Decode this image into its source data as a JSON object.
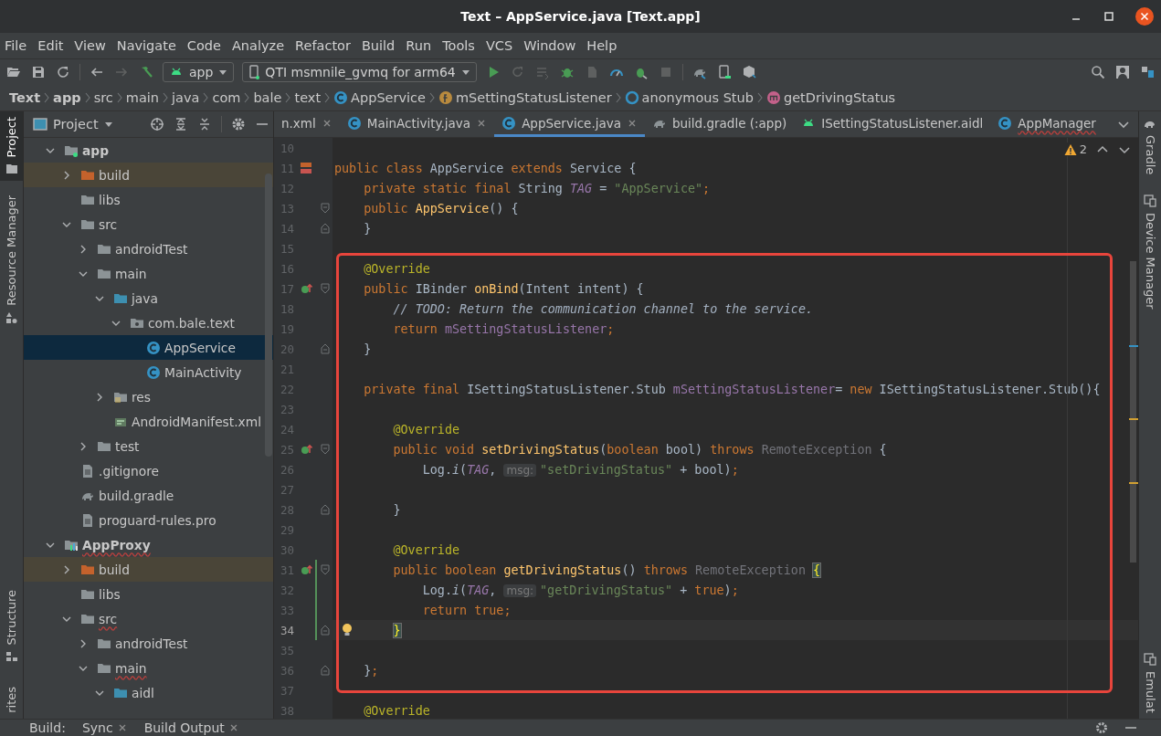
{
  "window": {
    "title": "Text – AppService.java [Text.app]"
  },
  "menu": [
    "File",
    "Edit",
    "View",
    "Navigate",
    "Code",
    "Analyze",
    "Refactor",
    "Build",
    "Run",
    "Tools",
    "VCS",
    "Window",
    "Help"
  ],
  "toolbar": {
    "configurations": [
      {
        "label": "app",
        "kind": "android"
      },
      {
        "label": "QTI msmnile_gvmq for arm64",
        "kind": "device"
      }
    ]
  },
  "breadcrumb": [
    {
      "label": "Text",
      "kind": "bold"
    },
    {
      "label": "app",
      "kind": "bold"
    },
    {
      "label": "src",
      "kind": "plain"
    },
    {
      "label": "main",
      "kind": "plain"
    },
    {
      "label": "java",
      "kind": "plain"
    },
    {
      "label": "com",
      "kind": "plain"
    },
    {
      "label": "bale",
      "kind": "plain"
    },
    {
      "label": "text",
      "kind": "plain"
    },
    {
      "label": "AppService",
      "kind": "class"
    },
    {
      "label": "mSettingStatusListener",
      "kind": "field"
    },
    {
      "label": "anonymous Stub",
      "kind": "anonymous"
    },
    {
      "label": "getDrivingStatus",
      "kind": "method"
    }
  ],
  "left_tool_strip": [
    {
      "label": "Project",
      "selected": true
    },
    {
      "label": "Resource Manager",
      "selected": false
    },
    {
      "label": "Structure",
      "selected": false
    },
    {
      "label": "rites",
      "selected": false
    }
  ],
  "project": {
    "title": "Project",
    "tree": [
      {
        "label": "app",
        "kind": "module",
        "expanded": true,
        "selected": false,
        "error": false,
        "children": [
          {
            "label": "build",
            "kind": "excluded",
            "expanded": false,
            "selected": false,
            "error": false
          },
          {
            "label": "libs",
            "kind": "folder",
            "selected": false,
            "error": false
          },
          {
            "label": "src",
            "kind": "folder",
            "expanded": true,
            "selected": false,
            "error": false,
            "children": [
              {
                "label": "androidTest",
                "kind": "folder",
                "expanded": false,
                "selected": false,
                "error": false
              },
              {
                "label": "main",
                "kind": "folder",
                "expanded": true,
                "selected": false,
                "error": false,
                "children": [
                  {
                    "label": "java",
                    "kind": "source",
                    "expanded": true,
                    "selected": false,
                    "error": false,
                    "children": [
                      {
                        "label": "com.bale.text",
                        "kind": "package",
                        "expanded": true,
                        "selected": false,
                        "error": false,
                        "children": [
                          {
                            "label": "AppService",
                            "kind": "class",
                            "selected": true,
                            "error": false
                          },
                          {
                            "label": "MainActivity",
                            "kind": "class",
                            "selected": false,
                            "error": false
                          }
                        ]
                      }
                    ]
                  },
                  {
                    "label": "res",
                    "kind": "res",
                    "expanded": false,
                    "selected": false,
                    "error": false
                  },
                  {
                    "label": "AndroidManifest.xml",
                    "kind": "manifest",
                    "selected": false,
                    "error": false
                  }
                ]
              },
              {
                "label": "test",
                "kind": "folder",
                "expanded": false,
                "selected": false,
                "error": false
              }
            ]
          },
          {
            "label": ".gitignore",
            "kind": "file",
            "selected": false,
            "error": false
          },
          {
            "label": "build.gradle",
            "kind": "gradle",
            "selected": false,
            "error": false
          },
          {
            "label": "proguard-rules.pro",
            "kind": "file",
            "selected": false,
            "error": false
          }
        ]
      },
      {
        "label": "AppProxy",
        "kind": "library",
        "expanded": true,
        "selected": false,
        "error": true,
        "children": [
          {
            "label": "build",
            "kind": "excluded",
            "expanded": false,
            "selected": false,
            "error": false
          },
          {
            "label": "libs",
            "kind": "folder",
            "selected": false,
            "error": false
          },
          {
            "label": "src",
            "kind": "folder",
            "expanded": true,
            "selected": false,
            "error": true,
            "children": [
              {
                "label": "androidTest",
                "kind": "folder",
                "expanded": false,
                "selected": false,
                "error": false
              },
              {
                "label": "main",
                "kind": "folder",
                "expanded": true,
                "selected": false,
                "error": true,
                "children": [
                  {
                    "label": "aidl",
                    "kind": "source",
                    "expanded": true,
                    "selected": false,
                    "error": false
                  }
                ]
              }
            ]
          }
        ]
      }
    ]
  },
  "editor": {
    "tabs": [
      {
        "label": "n.xml",
        "kind": "partial",
        "closable": true,
        "selected": false,
        "error": false
      },
      {
        "label": "MainActivity.java",
        "kind": "class",
        "closable": true,
        "selected": false,
        "error": false
      },
      {
        "label": "AppService.java",
        "kind": "class",
        "closable": true,
        "selected": true,
        "error": false
      },
      {
        "label": "build.gradle (:app)",
        "kind": "gradle",
        "closable": false,
        "selected": false,
        "error": false
      },
      {
        "label": "ISettingStatusListener.aidl",
        "kind": "android",
        "closable": false,
        "selected": false,
        "error": false
      },
      {
        "label": "AppManager",
        "kind": "class",
        "closable": false,
        "selected": false,
        "error": true
      }
    ],
    "problems": "2",
    "lines": [
      {
        "number": "10",
        "current": false,
        "changed": false
      },
      {
        "number": "11",
        "marker": {
          "kind": "class"
        },
        "current": false,
        "changed": false,
        "tokens": [
          {
            "kind": "kw",
            "text": "public class "
          },
          {
            "kind": "plain",
            "text": "AppService "
          },
          {
            "kind": "kw",
            "text": "extends "
          },
          {
            "kind": "plain",
            "text": "Service {"
          }
        ]
      },
      {
        "number": "12",
        "current": false,
        "changed": false,
        "tokens": [
          {
            "kind": "kw",
            "text": "    private static final "
          },
          {
            "kind": "plain",
            "text": "String "
          },
          {
            "kind": "tag",
            "text": "TAG"
          },
          {
            "kind": "plain",
            "text": " = "
          },
          {
            "kind": "str",
            "text": "\"AppService\""
          },
          {
            "kind": "kw",
            "text": ";"
          }
        ]
      },
      {
        "number": "13",
        "fold": {
          "kind": "open"
        },
        "current": false,
        "changed": false,
        "tokens": [
          {
            "kind": "kw",
            "text": "    public "
          },
          {
            "kind": "fn",
            "text": "AppService"
          },
          {
            "kind": "plain",
            "text": "() {"
          }
        ]
      },
      {
        "number": "14",
        "fold": {
          "kind": "close"
        },
        "current": false,
        "changed": false,
        "tokens": [
          {
            "kind": "plain",
            "text": "    }"
          }
        ]
      },
      {
        "number": "15",
        "current": false,
        "changed": false
      },
      {
        "number": "16",
        "current": false,
        "changed": false,
        "tokens": [
          {
            "kind": "ann",
            "text": "    @Override"
          }
        ]
      },
      {
        "number": "17",
        "marker": {
          "kind": "override"
        },
        "fold": {
          "kind": "open"
        },
        "current": false,
        "changed": false,
        "tokens": [
          {
            "kind": "kw",
            "text": "    public "
          },
          {
            "kind": "plain",
            "text": "IBinder "
          },
          {
            "kind": "fn",
            "text": "onBind"
          },
          {
            "kind": "plain",
            "text": "(Intent intent) {"
          }
        ]
      },
      {
        "number": "18",
        "current": false,
        "changed": false,
        "tokens": [
          {
            "kind": "comment",
            "text": "        // TODO: Return the communication channel to the service."
          }
        ]
      },
      {
        "number": "19",
        "current": false,
        "changed": false,
        "tokens": [
          {
            "kind": "kw",
            "text": "        return "
          },
          {
            "kind": "field",
            "text": "mSettingStatusListener"
          },
          {
            "kind": "kw",
            "text": ";"
          }
        ]
      },
      {
        "number": "20",
        "fold": {
          "kind": "close"
        },
        "current": false,
        "changed": false,
        "tokens": [
          {
            "kind": "plain",
            "text": "    }"
          }
        ]
      },
      {
        "number": "21",
        "current": false,
        "changed": false
      },
      {
        "number": "22",
        "current": false,
        "changed": false,
        "tokens": [
          {
            "kind": "kw",
            "text": "    private final "
          },
          {
            "kind": "plain",
            "text": "ISettingStatusListener.Stub "
          },
          {
            "kind": "field",
            "text": "mSettingStatusListener"
          },
          {
            "kind": "plain",
            "text": "= "
          },
          {
            "kind": "kw",
            "text": "new "
          },
          {
            "kind": "plain",
            "text": "ISettingStatusListener.Stub(){"
          }
        ]
      },
      {
        "number": "23",
        "current": false,
        "changed": false
      },
      {
        "number": "24",
        "current": false,
        "changed": false,
        "tokens": [
          {
            "kind": "ann",
            "text": "        @Override"
          }
        ]
      },
      {
        "number": "25",
        "marker": {
          "kind": "override"
        },
        "fold": {
          "kind": "open"
        },
        "current": false,
        "changed": false,
        "tokens": [
          {
            "kind": "kw",
            "text": "        public void "
          },
          {
            "kind": "fn",
            "text": "setDrivingStatus"
          },
          {
            "kind": "plain",
            "text": "("
          },
          {
            "kind": "kw",
            "text": "boolean "
          },
          {
            "kind": "plain",
            "text": "bool) "
          },
          {
            "kind": "kw",
            "text": "throws "
          },
          {
            "kind": "dim",
            "text": "RemoteException"
          },
          {
            "kind": "plain",
            "text": " {"
          }
        ]
      },
      {
        "number": "26",
        "current": false,
        "changed": false,
        "tokens": [
          {
            "kind": "plain",
            "text": "            Log."
          },
          {
            "kind": "static",
            "text": "i"
          },
          {
            "kind": "plain",
            "text": "("
          },
          {
            "kind": "tag",
            "text": "TAG"
          },
          {
            "kind": "plain",
            "text": ", "
          },
          {
            "kind": "hint",
            "text": "msg:"
          },
          {
            "kind": "str",
            "text": "\"setDrivingStatus\""
          },
          {
            "kind": "plain",
            "text": " + bool)"
          },
          {
            "kind": "kw",
            "text": ";"
          }
        ]
      },
      {
        "number": "27",
        "current": false,
        "changed": false
      },
      {
        "number": "28",
        "fold": {
          "kind": "close"
        },
        "current": false,
        "changed": false,
        "tokens": [
          {
            "kind": "plain",
            "text": "        }"
          }
        ]
      },
      {
        "number": "29",
        "current": false,
        "changed": false
      },
      {
        "number": "30",
        "current": false,
        "changed": false,
        "tokens": [
          {
            "kind": "ann",
            "text": "        @Override"
          }
        ]
      },
      {
        "number": "31",
        "marker": {
          "kind": "override"
        },
        "fold": {
          "kind": "open"
        },
        "current": false,
        "changed": true,
        "tokens": [
          {
            "kind": "kw",
            "text": "        public boolean "
          },
          {
            "kind": "fn",
            "text": "getDrivingStatus"
          },
          {
            "kind": "plain",
            "text": "() "
          },
          {
            "kind": "kw",
            "text": "throws "
          },
          {
            "kind": "dim",
            "text": "RemoteException "
          },
          {
            "kind": "match",
            "text": "{"
          }
        ]
      },
      {
        "number": "32",
        "current": false,
        "changed": true,
        "tokens": [
          {
            "kind": "plain",
            "text": "            Log."
          },
          {
            "kind": "static",
            "text": "i"
          },
          {
            "kind": "plain",
            "text": "("
          },
          {
            "kind": "tag",
            "text": "TAG"
          },
          {
            "kind": "plain",
            "text": ", "
          },
          {
            "kind": "hint",
            "text": "msg:"
          },
          {
            "kind": "str",
            "text": "\"getDrivingStatus\""
          },
          {
            "kind": "plain",
            "text": " + "
          },
          {
            "kind": "kw",
            "text": "true"
          },
          {
            "kind": "plain",
            "text": ")"
          },
          {
            "kind": "kw",
            "text": ";"
          }
        ]
      },
      {
        "number": "33",
        "current": false,
        "changed": true,
        "tokens": [
          {
            "kind": "kw",
            "text": "            return true;"
          }
        ]
      },
      {
        "number": "34",
        "marker": {
          "kind": "bulb"
        },
        "fold": {
          "kind": "close"
        },
        "current": true,
        "changed": true,
        "tokens": [
          {
            "kind": "match",
            "text": "        }"
          }
        ]
      },
      {
        "number": "35",
        "current": false,
        "changed": false
      },
      {
        "number": "36",
        "fold": {
          "kind": "close"
        },
        "current": false,
        "changed": false,
        "tokens": [
          {
            "kind": "plain",
            "text": "    }"
          },
          {
            "kind": "kw",
            "text": ";"
          }
        ]
      },
      {
        "number": "37",
        "current": false,
        "changed": false
      },
      {
        "number": "38",
        "current": false,
        "changed": false,
        "tokens": [
          {
            "kind": "ann",
            "text": "    @Override"
          }
        ]
      }
    ]
  },
  "right_tool_strip": [
    {
      "label": "Gradle",
      "kind": "gradle"
    },
    {
      "label": "Device Manager",
      "kind": "device"
    },
    {
      "label": "Emulat",
      "kind": "device"
    }
  ],
  "bottom_bar": {
    "label": "Build:",
    "tabs": [
      {
        "label": "Sync"
      },
      {
        "label": "Build Output"
      }
    ]
  }
}
